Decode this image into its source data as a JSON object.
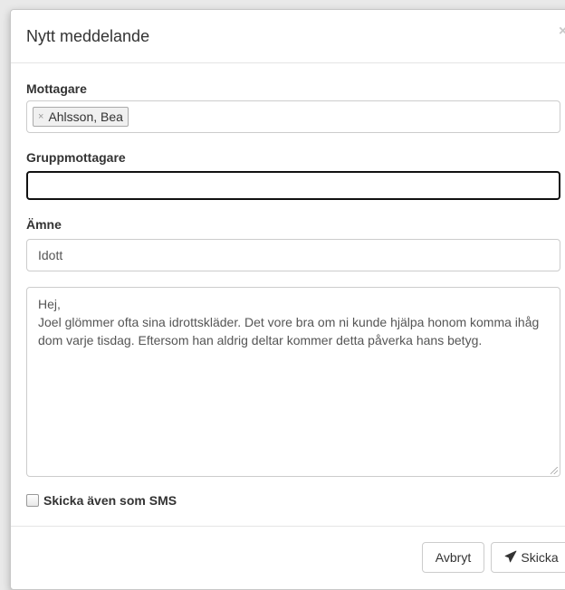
{
  "modal": {
    "title": "Nytt meddelande",
    "close_symbol": "×"
  },
  "recipients": {
    "label": "Mottagare",
    "tags": [
      {
        "remove_symbol": "×",
        "name": "Ahlsson, Bea"
      }
    ]
  },
  "group_recipients": {
    "label": "Gruppmottagare",
    "value": ""
  },
  "subject": {
    "label": "Ämne",
    "value": "Idott"
  },
  "message": {
    "lines": [
      "Hej,",
      "Joel glömmer ofta sina idrottskläder. Det vore bra om ni kunde hjälpa honom komma ihåg dom varje tisdag. Eftersom han aldrig deltar kommer detta påverka hans betyg."
    ]
  },
  "sms": {
    "label": "Skicka även som SMS",
    "checked": false
  },
  "footer": {
    "cancel_label": "Avbryt",
    "send_label": "Skicka",
    "send_icon": "paper-plane-icon"
  }
}
